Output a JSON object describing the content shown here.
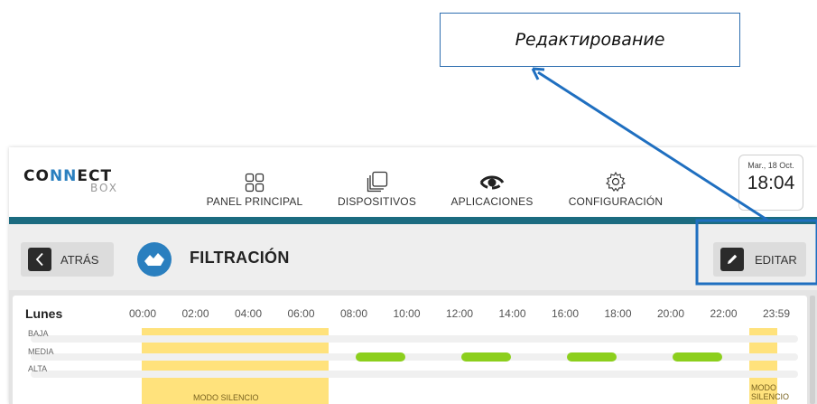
{
  "annotation": {
    "callout_text": "Редактирование"
  },
  "logo": {
    "top_a": "CO",
    "top_b": "NN",
    "top_c": "ECT",
    "bottom": "BOX"
  },
  "nav": {
    "panel": "PANEL PRINCIPAL",
    "devices": "DISPOSITIVOS",
    "apps": "APLICACIONES",
    "config": "CONFIGURACIÓN",
    "active": "APLICACIONES"
  },
  "datetime": {
    "date": "Mar., 18 Oct.",
    "time": "18:04"
  },
  "subheader": {
    "back_label": "ATRÁS",
    "title": "FILTRACIÓN",
    "edit_label": "EDITAR"
  },
  "schedule": {
    "day": "Lunes",
    "ticks": [
      "00:00",
      "02:00",
      "04:00",
      "06:00",
      "08:00",
      "10:00",
      "12:00",
      "14:00",
      "16:00",
      "18:00",
      "20:00",
      "22:00",
      "23:59"
    ],
    "levels": [
      "BAJA",
      "MEDIA",
      "ALTA"
    ],
    "silent_label": "MODO SILENCIO",
    "silent_label_line1": "MODO",
    "silent_label_line2": "SILENCIO",
    "silent_periods": [
      {
        "start": "00:00",
        "end": "07:00"
      },
      {
        "start": "23:00",
        "end": "23:59"
      }
    ],
    "media_runs": [
      {
        "start": "08:00",
        "end": "10:00"
      },
      {
        "start": "12:00",
        "end": "14:00"
      },
      {
        "start": "16:00",
        "end": "18:00"
      },
      {
        "start": "20:00",
        "end": "22:00"
      }
    ]
  },
  "colors": {
    "teal": "#1b6b80",
    "accent_blue": "#2a7fbf",
    "silent_yellow": "#ffdf6e",
    "media_green": "#8ccf1d",
    "annotation_blue": "#1f6fc0"
  }
}
